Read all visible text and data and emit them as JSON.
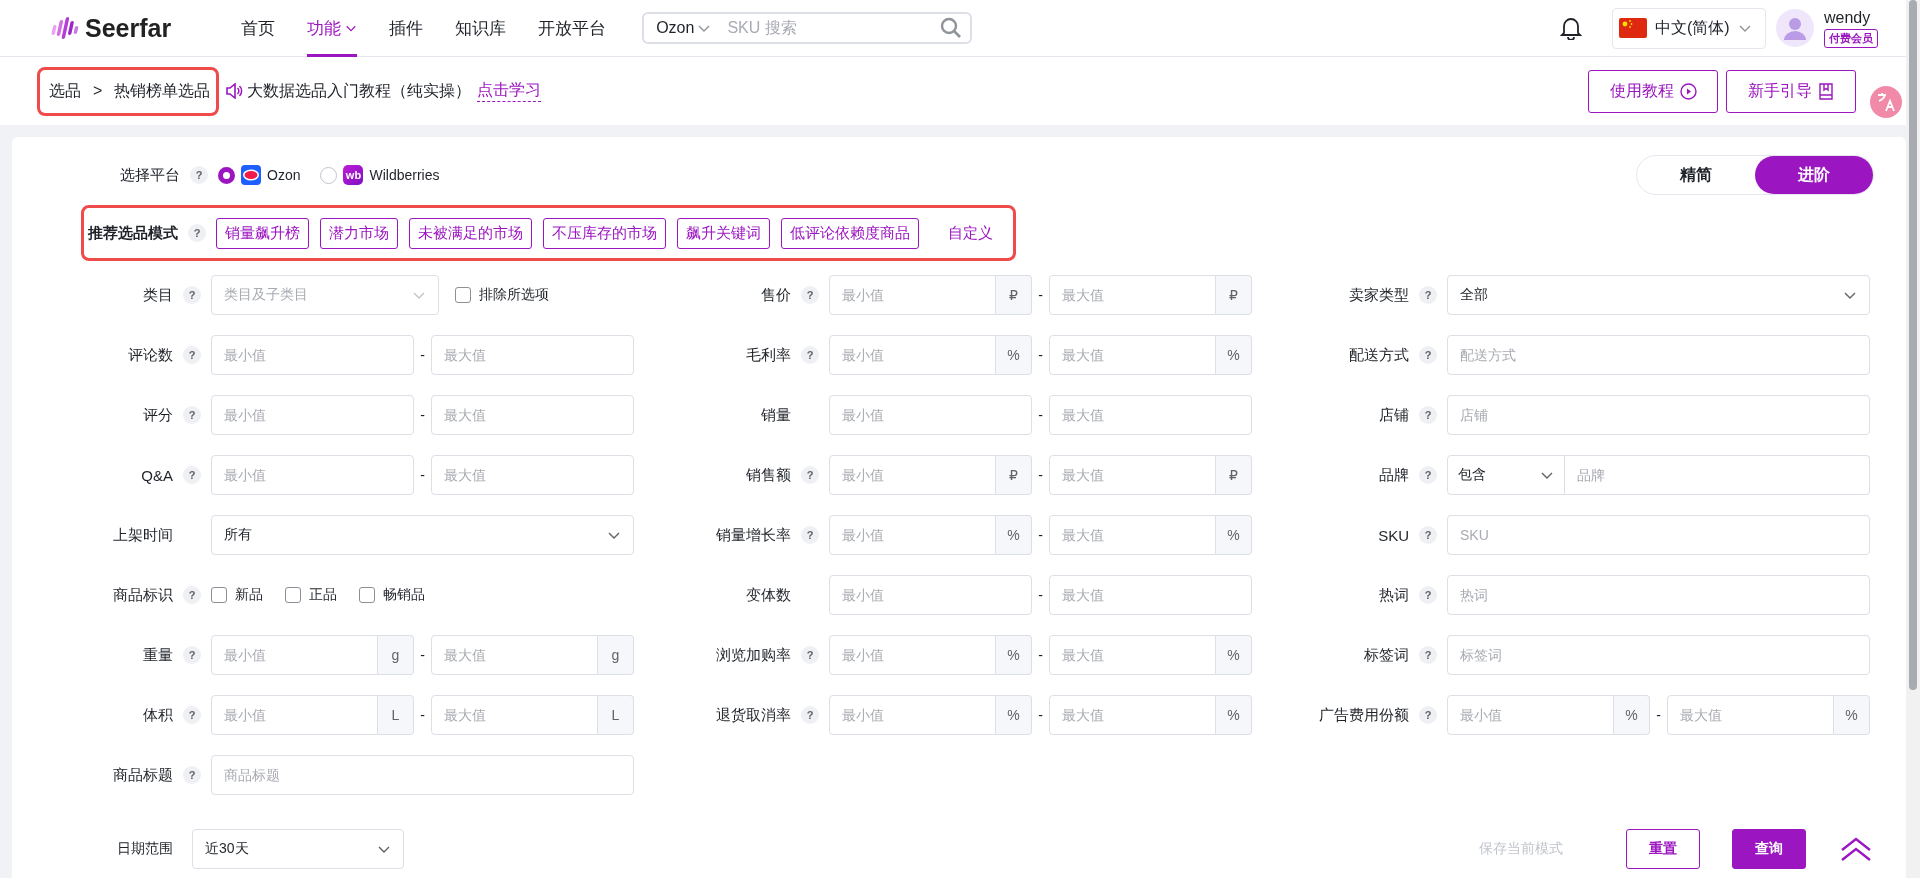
{
  "header": {
    "logo": "Seerfar",
    "nav": [
      {
        "label": "首页",
        "selected": false,
        "dropdown": false
      },
      {
        "label": "功能",
        "selected": true,
        "dropdown": true
      },
      {
        "label": "插件",
        "selected": false,
        "dropdown": false
      },
      {
        "label": "知识库",
        "selected": false,
        "dropdown": false
      },
      {
        "label": "开放平台",
        "selected": false,
        "dropdown": false
      }
    ],
    "search": {
      "platform": "Ozon",
      "placeholder": "SKU 搜索"
    },
    "language": "中文(简体)",
    "user": {
      "name": "wendy",
      "badge": "付费会员"
    }
  },
  "breadcrumb": {
    "items": [
      "选品",
      "热销榜单选品"
    ],
    "separator": ">"
  },
  "announcement": {
    "text": "大数据选品入门教程（纯实操）",
    "link": "点击学习"
  },
  "header_buttons": [
    {
      "label": "使用教程",
      "kind": "play"
    },
    {
      "label": "新手引导",
      "kind": "book"
    }
  ],
  "platform": {
    "label": "选择平台",
    "help": "?",
    "options": [
      {
        "label": "Ozon",
        "selected": true,
        "kind": "ozon"
      },
      {
        "label": "Wildberries",
        "selected": false,
        "kind": "wb",
        "logo_text": "wb"
      }
    ]
  },
  "view_toggle": [
    {
      "label": "精简",
      "selected": false
    },
    {
      "label": "进阶",
      "selected": true
    }
  ],
  "modes": {
    "label": "推荐选品模式",
    "help": "?",
    "tags": [
      "销量飙升榜",
      "潜力市场",
      "未被满足的市场",
      "不压库存的市场",
      "飙升关键词",
      "低评论依赖度商品"
    ],
    "custom": "自定义"
  },
  "columns": [
    [
      {
        "label": "类目",
        "help": "?",
        "kind": "category",
        "placeholder": "类目及子类目",
        "checkbox": {
          "label": "排除所选项",
          "checked": false
        }
      },
      {
        "label": "评论数",
        "help": "?",
        "kind": "range",
        "min": {
          "placeholder": "最小值"
        },
        "separator": "-",
        "max": {
          "placeholder": "最大值"
        }
      },
      {
        "label": "评分",
        "help": "?",
        "kind": "range",
        "min": {
          "placeholder": "最小值"
        },
        "separator": "-",
        "max": {
          "placeholder": "最大值"
        }
      },
      {
        "label": "Q&A",
        "help": "?",
        "kind": "range",
        "min": {
          "placeholder": "最小值"
        },
        "separator": "-",
        "max": {
          "placeholder": "最大值"
        }
      },
      {
        "label": "上架时间",
        "kind": "select",
        "value": "所有"
      },
      {
        "label": "商品标识",
        "help": "?",
        "kind": "checkboxes",
        "options": [
          {
            "label": "新品",
            "checked": false
          },
          {
            "label": "正品",
            "checked": false
          },
          {
            "label": "畅销品",
            "checked": false
          }
        ]
      },
      {
        "label": "重量",
        "help": "?",
        "kind": "range",
        "min": {
          "placeholder": "最小值",
          "unit": "g"
        },
        "separator": "-",
        "max": {
          "placeholder": "最大值",
          "unit": "g"
        }
      },
      {
        "label": "体积",
        "help": "?",
        "kind": "range",
        "min": {
          "placeholder": "最小值",
          "unit": "L"
        },
        "separator": "-",
        "max": {
          "placeholder": "最大值",
          "unit": "L"
        }
      },
      {
        "label": "商品标题",
        "help": "?",
        "kind": "text",
        "placeholder": "商品标题"
      }
    ],
    [
      {
        "label": "售价",
        "help": "?",
        "kind": "range",
        "min": {
          "placeholder": "最小值",
          "unit": "₽"
        },
        "separator": "-",
        "max": {
          "placeholder": "最大值",
          "unit": "₽"
        }
      },
      {
        "label": "毛利率",
        "help": "?",
        "kind": "range",
        "min": {
          "placeholder": "最小值",
          "unit": "%"
        },
        "separator": "-",
        "max": {
          "placeholder": "最大值",
          "unit": "%"
        }
      },
      {
        "label": "销量",
        "kind": "range",
        "min": {
          "placeholder": "最小值"
        },
        "separator": "-",
        "max": {
          "placeholder": "最大值"
        }
      },
      {
        "label": "销售额",
        "help": "?",
        "kind": "range",
        "min": {
          "placeholder": "最小值",
          "unit": "₽"
        },
        "separator": "-",
        "max": {
          "placeholder": "最大值",
          "unit": "₽"
        }
      },
      {
        "label": "销量增长率",
        "help": "?",
        "kind": "range",
        "min": {
          "placeholder": "最小值",
          "unit": "%"
        },
        "separator": "-",
        "max": {
          "placeholder": "最大值",
          "unit": "%"
        }
      },
      {
        "label": "变体数",
        "kind": "range",
        "min": {
          "placeholder": "最小值"
        },
        "separator": "-",
        "max": {
          "placeholder": "最大值"
        }
      },
      {
        "label": "浏览加购率",
        "help": "?",
        "kind": "range",
        "min": {
          "placeholder": "最小值",
          "unit": "%"
        },
        "separator": "-",
        "max": {
          "placeholder": "最大值",
          "unit": "%"
        }
      },
      {
        "label": "退货取消率",
        "help": "?",
        "kind": "range",
        "min": {
          "placeholder": "最小值",
          "unit": "%"
        },
        "separator": "-",
        "max": {
          "placeholder": "最大值",
          "unit": "%"
        }
      }
    ],
    [
      {
        "label": "卖家类型",
        "help": "?",
        "kind": "select",
        "value": "全部"
      },
      {
        "label": "配送方式",
        "help": "?",
        "kind": "text",
        "placeholder": "配送方式"
      },
      {
        "label": "店铺",
        "help": "?",
        "kind": "text",
        "placeholder": "店铺"
      },
      {
        "label": "品牌",
        "help": "?",
        "kind": "select_text",
        "value": "包含",
        "placeholder": "品牌"
      },
      {
        "label": "SKU",
        "help": "?",
        "kind": "text",
        "placeholder": "SKU"
      },
      {
        "label": "热词",
        "help": "?",
        "kind": "text",
        "placeholder": "热词"
      },
      {
        "label": "标签词",
        "help": "?",
        "kind": "text",
        "placeholder": "标签词"
      },
      {
        "label": "广告费用份额",
        "help": "?",
        "kind": "range",
        "min": {
          "placeholder": "最小值",
          "unit": "%"
        },
        "separator": "-",
        "max": {
          "placeholder": "最大值",
          "unit": "%"
        }
      }
    ]
  ],
  "date_range": {
    "label": "日期范围",
    "value": "近30天"
  },
  "actions": [
    {
      "label": "保存当前模式",
      "kind": "ghost",
      "disabled": true
    },
    {
      "label": "重置",
      "kind": "outline",
      "disabled": false
    },
    {
      "label": "查询",
      "kind": "primary",
      "disabled": false
    }
  ]
}
